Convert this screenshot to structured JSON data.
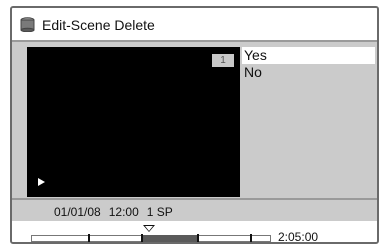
{
  "header": {
    "title": "Edit-Scene Delete",
    "icon": "disc-icon"
  },
  "preview": {
    "scene_number": "1",
    "play_icon": "play-icon"
  },
  "options": [
    {
      "label": "Yes",
      "selected": true
    },
    {
      "label": "No",
      "selected": false
    }
  ],
  "info": {
    "date": "01/01/08",
    "time": "12:00",
    "title_number": "1",
    "mode": "SP"
  },
  "timeline": {
    "total_time": "2:05:00",
    "cursor_icon": "position-marker-icon"
  },
  "colors": {
    "panel": "#cbcbcb",
    "preview": "#000000",
    "selected_bg": "#ffffff",
    "scene_segment": "#5a5a5a"
  }
}
